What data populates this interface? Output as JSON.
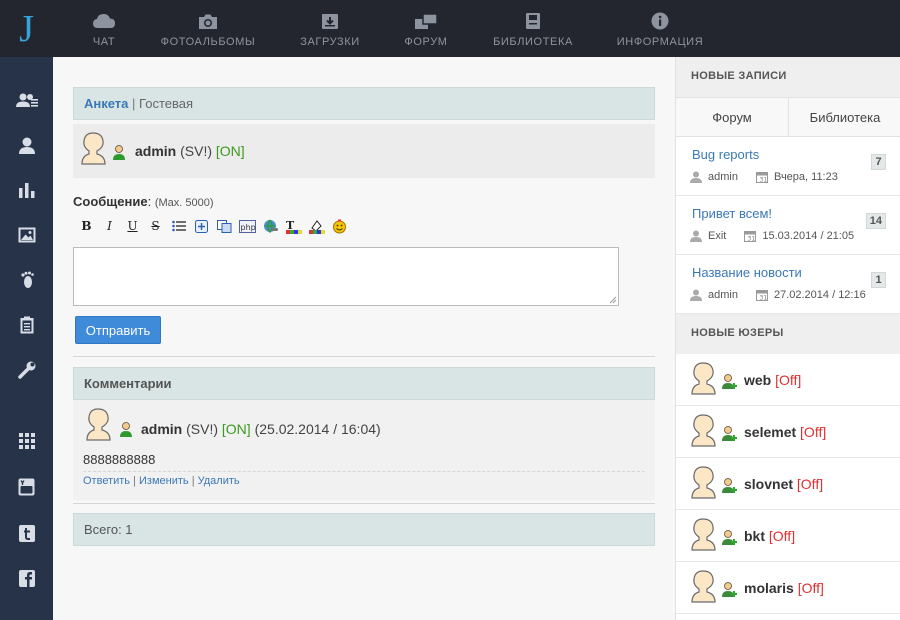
{
  "logo": "J",
  "nav": [
    {
      "label": "ЧАТ",
      "icon": "cloud-icon"
    },
    {
      "label": "ФОТОАЛЬБОМЫ",
      "icon": "camera-icon"
    },
    {
      "label": "ЗАГРУЗКИ",
      "icon": "download-icon"
    },
    {
      "label": "ФОРУМ",
      "icon": "forum-icon"
    },
    {
      "label": "БИБЛИОТЕКА",
      "icon": "book-icon"
    },
    {
      "label": "ИНФОРМАЦИЯ",
      "icon": "info-icon"
    }
  ],
  "sidebar_icons": [
    "users-icon",
    "user-icon",
    "stats-icon",
    "image-icon",
    "footprint-icon",
    "clipboard-icon",
    "wrench-icon",
    "grid-icon",
    "youtube-icon",
    "tumblr-icon",
    "facebook-icon"
  ],
  "tabs": {
    "active": "Анкета",
    "separator": "|",
    "inactive": "Гостевая"
  },
  "profile": {
    "name": "admin",
    "suffix": "(SV!)",
    "status": "[ON]"
  },
  "message": {
    "label": "Сообщение",
    "colon": ":",
    "limit": "(Max. 5000)"
  },
  "toolbar": [
    "B",
    "I",
    "U",
    "S",
    "list",
    "add",
    "copy",
    "php",
    "link",
    "color",
    "bgcolor",
    "smile"
  ],
  "send_label": "Отправить",
  "comments": {
    "title": "Комментарии",
    "item": {
      "name": "admin",
      "suffix": "(SV!)",
      "status": "[ON]",
      "date": "(25.02.2014 / 16:04)",
      "text": "8888888888",
      "actions": [
        "Ответить",
        "Изменить",
        "Удалить"
      ]
    },
    "total": "Всего: 1"
  },
  "right": {
    "new_posts_title": "НОВЫЕ ЗАПИСИ",
    "tabs": [
      "Форум",
      "Библиотека"
    ],
    "posts": [
      {
        "title": "Bug reports",
        "author": "admin",
        "date": "Вчера, 11:23",
        "count": "7"
      },
      {
        "title": "Привет всем!",
        "author": "Exit",
        "date": "15.03.2014 / 21:05",
        "count": "14"
      },
      {
        "title": "Название новости",
        "author": "admin",
        "date": "27.02.2014 / 12:16",
        "count": "1"
      }
    ],
    "new_users_title": "НОВЫЕ  ЮЗЕРЫ",
    "users": [
      {
        "name": "web",
        "status": "[Off]"
      },
      {
        "name": "selemet",
        "status": "[Off]"
      },
      {
        "name": "slovnet",
        "status": "[Off]"
      },
      {
        "name": "bkt",
        "status": "[Off]"
      },
      {
        "name": "molaris",
        "status": "[Off]"
      }
    ]
  },
  "colors": {
    "topbar": "#23262e",
    "sidebar": "#263349",
    "accent": "#37a3d9",
    "link": "#3a79b7",
    "button": "#3f8ad9",
    "online": "#3b9a1e",
    "offline": "#e03030"
  }
}
